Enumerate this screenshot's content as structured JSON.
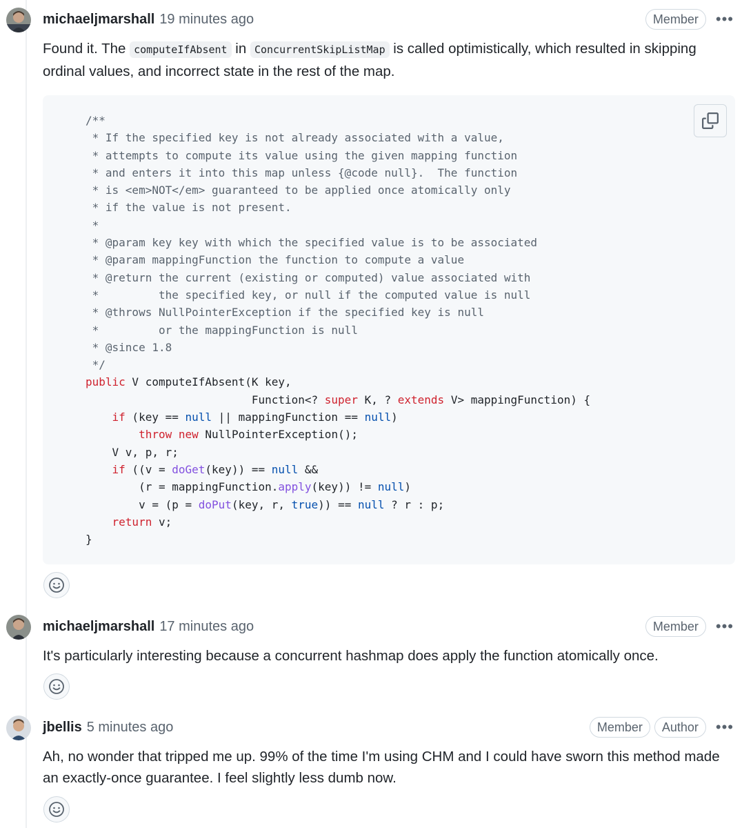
{
  "comments": [
    {
      "author": "michaeljmarshall",
      "time": "19 minutes ago",
      "badges": [
        "Member"
      ],
      "text_before": "Found it. The ",
      "code1": "computeIfAbsent",
      "text_mid": " in ",
      "code2": "ConcurrentSkipListMap",
      "text_after": " is called optimistically, which resulted in skipping ordinal values, and incorrect state in the rest of the map.",
      "code_lines": [
        "/**",
        " * If the specified key is not already associated with a value,",
        " * attempts to compute its value using the given mapping function",
        " * and enters it into this map unless {@code null}.  The function",
        " * is <em>NOT</em> guaranteed to be applied once atomically only",
        " * if the value is not present.",
        " *",
        " * @param key key with which the specified value is to be associated",
        " * @param mappingFunction the function to compute a value",
        " * @return the current (existing or computed) value associated with",
        " *         the specified key, or null if the computed value is null",
        " * @throws NullPointerException if the specified key is null",
        " *         or the mappingFunction is null",
        " * @since 1.8",
        " */",
        "public V computeIfAbsent(K key,",
        "                         Function<? super K, ? extends V> mappingFunction) {",
        "    if (key == null || mappingFunction == null)",
        "        throw new NullPointerException();",
        "    V v, p, r;",
        "    if ((v = doGet(key)) == null &&",
        "        (r = mappingFunction.apply(key)) != null)",
        "        v = (p = doPut(key, r, true)) == null ? r : p;",
        "    return v;",
        "}"
      ]
    },
    {
      "author": "michaeljmarshall",
      "time": "17 minutes ago",
      "badges": [
        "Member"
      ],
      "text": "It's particularly interesting because a concurrent hashmap does apply the function atomically once."
    },
    {
      "author": "jbellis",
      "time": "5 minutes ago",
      "badges": [
        "Member",
        "Author"
      ],
      "text": "Ah, no wonder that tripped me up. 99% of the time I'm using CHM and I could have sworn this method made an exactly-once guarantee. I feel slightly less dumb now."
    }
  ],
  "icons": {
    "kebab": "kebab-horizontal-icon",
    "copy": "copy-icon",
    "smiley": "smiley-icon"
  },
  "colors": {
    "comment": "#59636e",
    "keyword": "#cf222e",
    "constant": "#0550ae",
    "function": "#8250df"
  }
}
